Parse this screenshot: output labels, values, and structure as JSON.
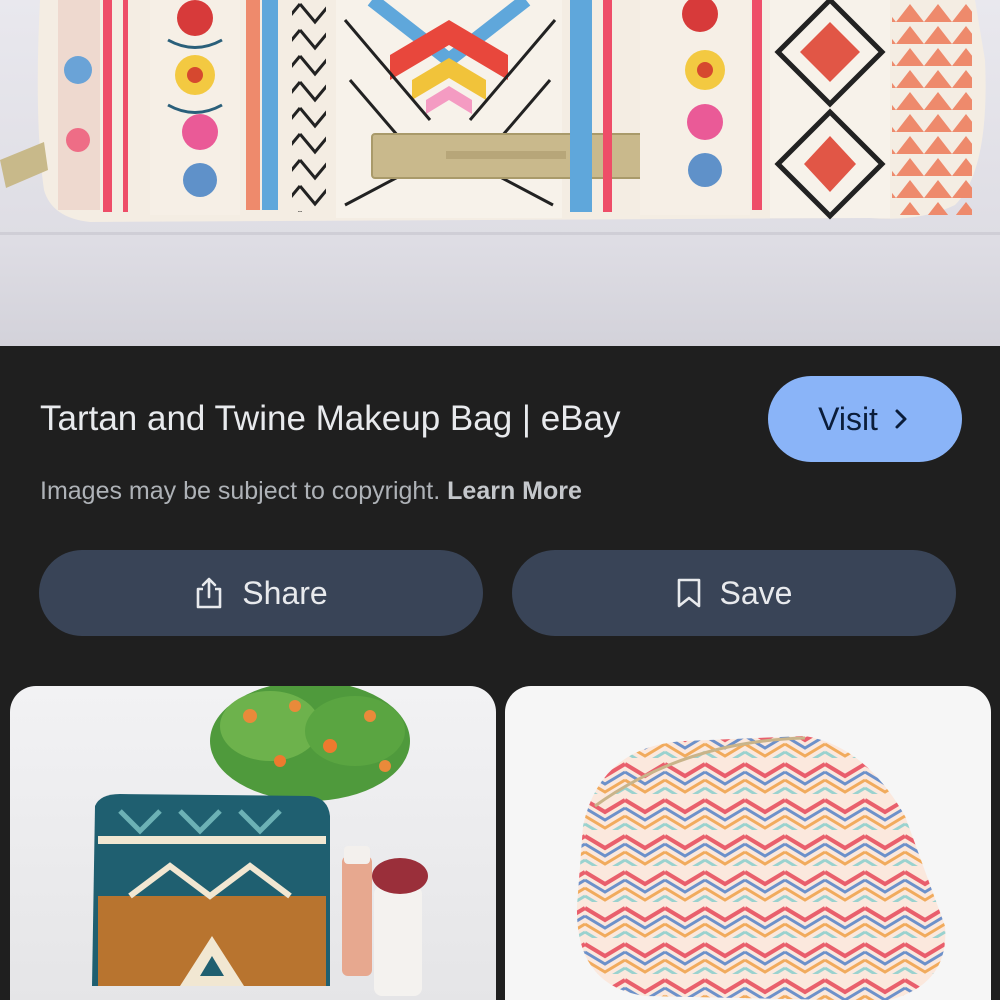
{
  "result": {
    "title": "Tartan and Twine Makeup Bag | eBay",
    "visit_label": "Visit",
    "copyright_text": "Images may be subject to copyright.",
    "learn_more_label": "Learn More"
  },
  "actions": {
    "share_label": "Share",
    "save_label": "Save"
  },
  "icons": {
    "visit": "chevron-right-icon",
    "share": "share-icon",
    "save": "bookmark-icon"
  },
  "colors": {
    "background": "#1f1f1f",
    "visit_button": "#8ab4f8",
    "action_button": "#394457",
    "text_primary": "#e8eaed",
    "text_secondary": "#aeb2b7"
  }
}
